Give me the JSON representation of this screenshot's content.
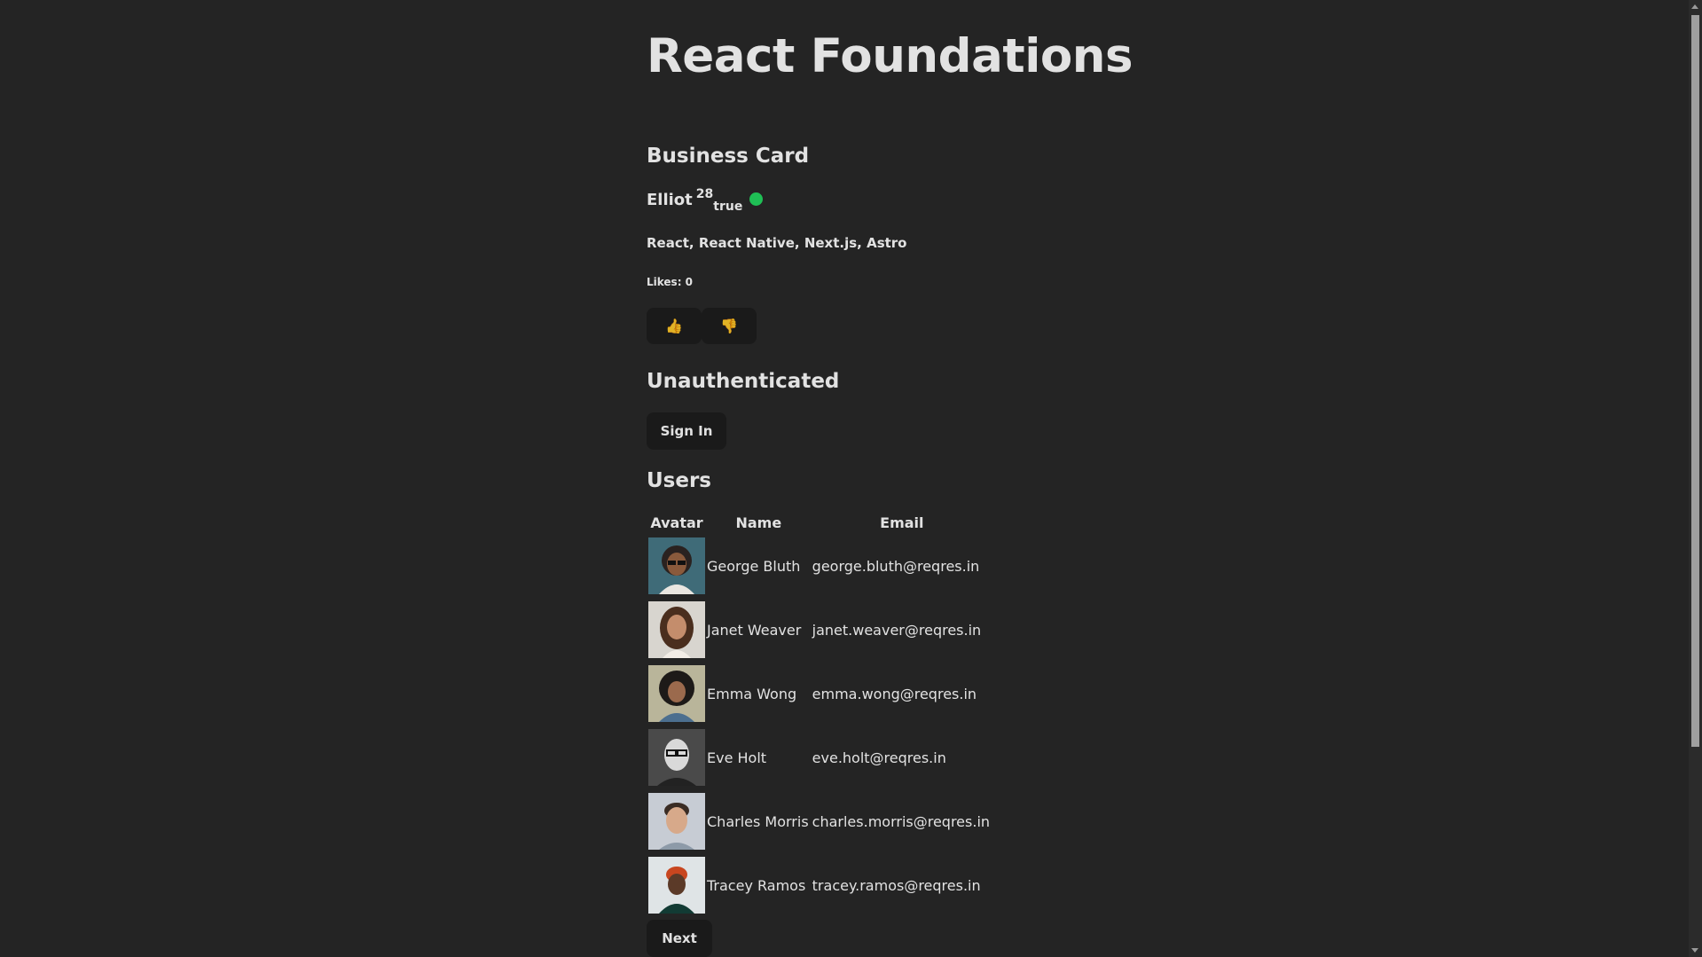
{
  "page": {
    "title": "React Foundations"
  },
  "business_card": {
    "heading": "Business Card",
    "name": "Elliot",
    "age": "28",
    "status": "true",
    "status_dot_color": "#1fbf55",
    "skills": "React, React Native, Next.js, Astro",
    "likes_label": "Likes: 0",
    "like_button": "👍",
    "dislike_button": "👎"
  },
  "auth": {
    "heading": "Unauthenticated",
    "sign_in_label": "Sign In"
  },
  "users": {
    "heading": "Users",
    "columns": [
      "Avatar",
      "Name",
      "Email"
    ],
    "rows": [
      {
        "name": "George Bluth",
        "email": "george.bluth@reqres.in"
      },
      {
        "name": "Janet Weaver",
        "email": "janet.weaver@reqres.in"
      },
      {
        "name": "Emma Wong",
        "email": "emma.wong@reqres.in"
      },
      {
        "name": "Eve Holt",
        "email": "eve.holt@reqres.in"
      },
      {
        "name": "Charles Morris",
        "email": "charles.morris@reqres.in"
      },
      {
        "name": "Tracey Ramos",
        "email": "tracey.ramos@reqres.in"
      }
    ],
    "next_label": "Next"
  }
}
